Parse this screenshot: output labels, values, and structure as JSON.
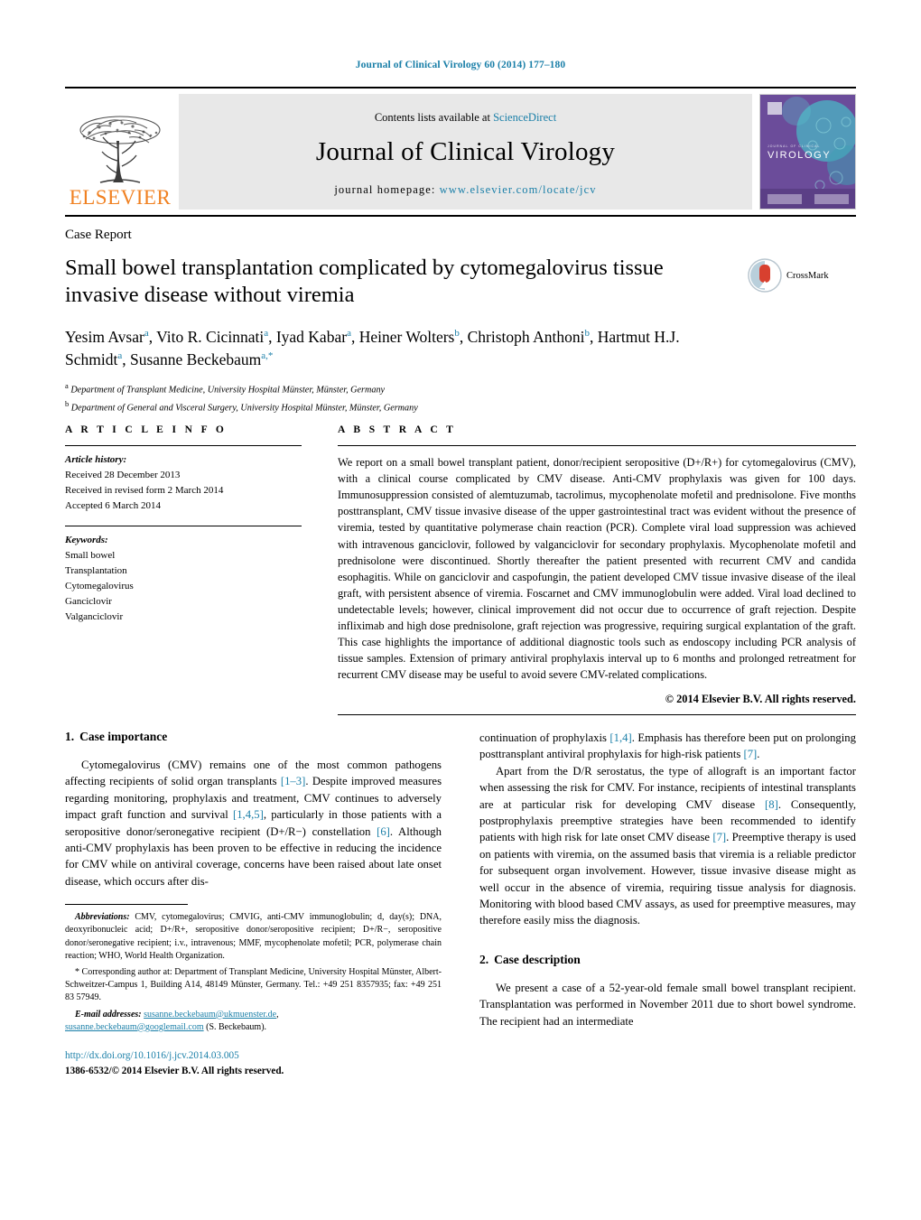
{
  "running_head": "Journal of Clinical Virology 60 (2014) 177–180",
  "masthead": {
    "contents_prefix": "Contents lists available at ",
    "sciencedirect": "ScienceDirect",
    "journal_name": "Journal of Clinical Virology",
    "homepage_label": "journal homepage: ",
    "homepage_url": "www.elsevier.com/locate/jcv",
    "publisher": "ELSEVIER",
    "cover_title": "VIROLOGY",
    "cover_overline": "JOURNAL OF CLINICAL",
    "accent_orange": "#f08122",
    "accent_teal": "#1a7fa8",
    "cover_purple": "#6b4c9a",
    "cover_teal": "#49b6c4"
  },
  "article": {
    "doctype": "Case Report",
    "title": "Small bowel transplantation complicated by cytomegalovirus tissue invasive disease without viremia",
    "crossmark_label": "CrossMark",
    "authors_html": "Yesim Avsar<sup>a</sup>, Vito R. Cicinnati<sup>a</sup>, Iyad Kabar<sup>a</sup>, Heiner Wolters<sup>b</sup>, Christoph Anthoni<sup>b</sup>, Hartmut H.J. Schmidt<sup>a</sup>, Susanne Beckebaum<sup>a,*</sup>",
    "affiliations": [
      {
        "marker": "a",
        "text": "Department of Transplant Medicine, University Hospital Münster, Münster, Germany"
      },
      {
        "marker": "b",
        "text": "Department of General and Visceral Surgery, University Hospital Münster, Münster, Germany"
      }
    ]
  },
  "article_info": {
    "heading": "A R T I C L E    I N F O",
    "history_label": "Article history:",
    "history": [
      "Received 28 December 2013",
      "Received in revised form 2 March 2014",
      "Accepted 6 March 2014"
    ],
    "keywords_label": "Keywords:",
    "keywords": [
      "Small bowel",
      "Transplantation",
      "Cytomegalovirus",
      "Ganciclovir",
      "Valganciclovir"
    ]
  },
  "abstract": {
    "heading": "A B S T R A C T",
    "text": "We report on a small bowel transplant patient, donor/recipient seropositive (D+/R+) for cytomegalovirus (CMV), with a clinical course complicated by CMV disease. Anti-CMV prophylaxis was given for 100 days. Immunosuppression consisted of alemtuzumab, tacrolimus, mycophenolate mofetil and prednisolone. Five months posttransplant, CMV tissue invasive disease of the upper gastrointestinal tract was evident without the presence of viremia, tested by quantitative polymerase chain reaction (PCR). Complete viral load suppression was achieved with intravenous ganciclovir, followed by valganciclovir for secondary prophylaxis. Mycophenolate mofetil and prednisolone were discontinued. Shortly thereafter the patient presented with recurrent CMV and candida esophagitis. While on ganciclovir and caspofungin, the patient developed CMV tissue invasive disease of the ileal graft, with persistent absence of viremia. Foscarnet and CMV immunoglobulin were added. Viral load declined to undetectable levels; however, clinical improvement did not occur due to occurrence of graft rejection. Despite infliximab and high dose prednisolone, graft rejection was progressive, requiring surgical explantation of the graft. This case highlights the importance of additional diagnostic tools such as endoscopy including PCR analysis of tissue samples. Extension of primary antiviral prophylaxis interval up to 6 months and prolonged retreatment for recurrent CMV disease may be useful to avoid severe CMV-related complications.",
    "copyright": "© 2014 Elsevier B.V. All rights reserved."
  },
  "sections": {
    "s1_number": "1.",
    "s1_title": "Case importance",
    "s1_p1_html": "Cytomegalovirus (CMV) remains one of the most common pathogens affecting recipients of solid organ transplants <span class=\"ref\">[1–3]</span>. Despite improved measures regarding monitoring, prophylaxis and treatment, CMV continues to adversely impact graft function and survival <span class=\"ref\">[1,4,5]</span>, particularly in those patients with a seropositive donor/seronegative recipient (D+/R−) constellation <span class=\"ref\">[6]</span>. Although anti-CMV prophylaxis has been proven to be effective in reducing the incidence for CMV while on antiviral coverage, concerns have been raised about late onset disease, which occurs after dis-",
    "s1_p1_cont_html": "continuation of prophylaxis <span class=\"ref\">[1,4]</span>. Emphasis has therefore been put on prolonging posttransplant antiviral prophylaxis for high-risk patients <span class=\"ref\">[7]</span>.",
    "s1_p2_html": "Apart from the D/R serostatus, the type of allograft is an important factor when assessing the risk for CMV. For instance, recipients of intestinal transplants are at particular risk for developing CMV disease <span class=\"ref\">[8]</span>. Consequently, postprophylaxis preemptive strategies have been recommended to identify patients with high risk for late onset CMV disease <span class=\"ref\">[7]</span>. Preemptive therapy is used on patients with viremia, on the assumed basis that viremia is a reliable predictor for subsequent organ involvement. However, tissue invasive disease might as well occur in the absence of viremia, requiring tissue analysis for diagnosis. Monitoring with blood based CMV assays, as used for preemptive measures, may therefore easily miss the diagnosis.",
    "s2_number": "2.",
    "s2_title": "Case description",
    "s2_p1_html": "We present a case of a 52-year-old female small bowel transplant recipient. Transplantation was performed in November 2011 due to short bowel syndrome. The recipient had an intermediate"
  },
  "footnotes": {
    "abbrev_label": "Abbreviations:",
    "abbrev_text": " CMV, cytomegalovirus; CMVIG, anti-CMV immunoglobulin; d, day(s); DNA, deoxyribonucleic acid; D+/R+, seropositive donor/seropositive recipient; D+/R−, seropositive donor/seronegative recipient; i.v., intravenous; MMF, mycophenolate mofetil; PCR, polymerase chain reaction; WHO, World Health Organization.",
    "corresponding_text": "* Corresponding author at: Department of Transplant Medicine, University Hospital Münster, Albert-Schweitzer-Campus 1, Building A14, 48149 Münster, Germany. Tel.: +49 251 8357935; fax: +49 251 83 57949.",
    "email_label": "E-mail addresses:",
    "email_1": "susanne.beckebaum@ukmuenster.de",
    "email_2": "susanne.beckebaum@googlemail.com",
    "email_suffix": " (S. Beckebaum).",
    "doi": "http://dx.doi.org/10.1016/j.jcv.2014.03.005",
    "issn_line": "1386-6532/© 2014 Elsevier B.V. All rights reserved."
  }
}
